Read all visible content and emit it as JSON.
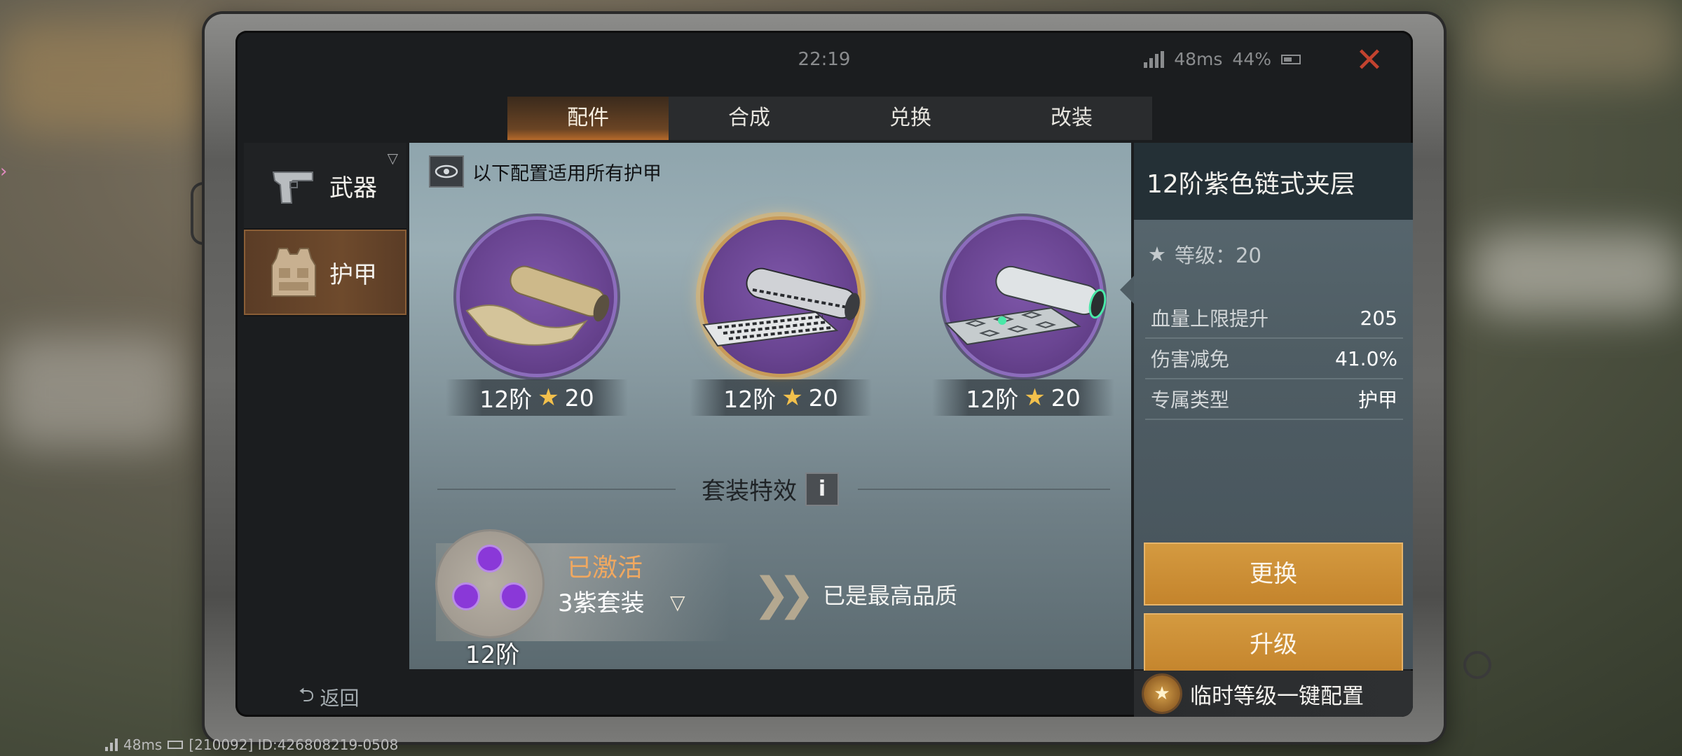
{
  "status": {
    "time": "22:19",
    "ping": "48ms",
    "battery": "44%"
  },
  "tabs": [
    {
      "label": "配件",
      "active": true
    },
    {
      "label": "合成",
      "active": false
    },
    {
      "label": "兑换",
      "active": false
    },
    {
      "label": "改装",
      "active": false
    }
  ],
  "sidenav": [
    {
      "label": "武器",
      "icon": "pistol-icon",
      "active": false
    },
    {
      "label": "护甲",
      "icon": "armor-vest-icon",
      "active": true
    }
  ],
  "center": {
    "note": "以下配置适用所有护甲",
    "items": [
      {
        "tier": "12阶",
        "stars": "20",
        "icon": "fabric-roll-icon",
        "selected": false
      },
      {
        "tier": "12阶",
        "stars": "20",
        "icon": "chain-roll-icon",
        "selected": true
      },
      {
        "tier": "12阶",
        "stars": "20",
        "icon": "hex-roll-icon",
        "selected": false
      }
    ],
    "set_title": "套装特效",
    "info_label": "i",
    "set_status": "已激活",
    "set_name": "3紫套装",
    "set_level": "12阶",
    "max_note": "已是最高品质"
  },
  "detail": {
    "title": "12阶紫色链式夹层",
    "level_label": "等级：20",
    "stats": [
      {
        "label": "血量上限提升",
        "value": "205"
      },
      {
        "label": "伤害减免",
        "value": "41.0%"
      },
      {
        "label": "专属类型",
        "value": "护甲"
      }
    ],
    "replace_label": "更换",
    "upgrade_label": "升级"
  },
  "footer": {
    "back_label": "返回",
    "quick_config_label": "临时等级一键配置",
    "debug_ping": "48ms",
    "debug_id": "[210092] ID:426808219-0508"
  },
  "colors": {
    "accent_orange": "#c4842c",
    "close_red": "#c2432f",
    "purple": "#6a4592",
    "star_gold": "#f2c04c"
  }
}
